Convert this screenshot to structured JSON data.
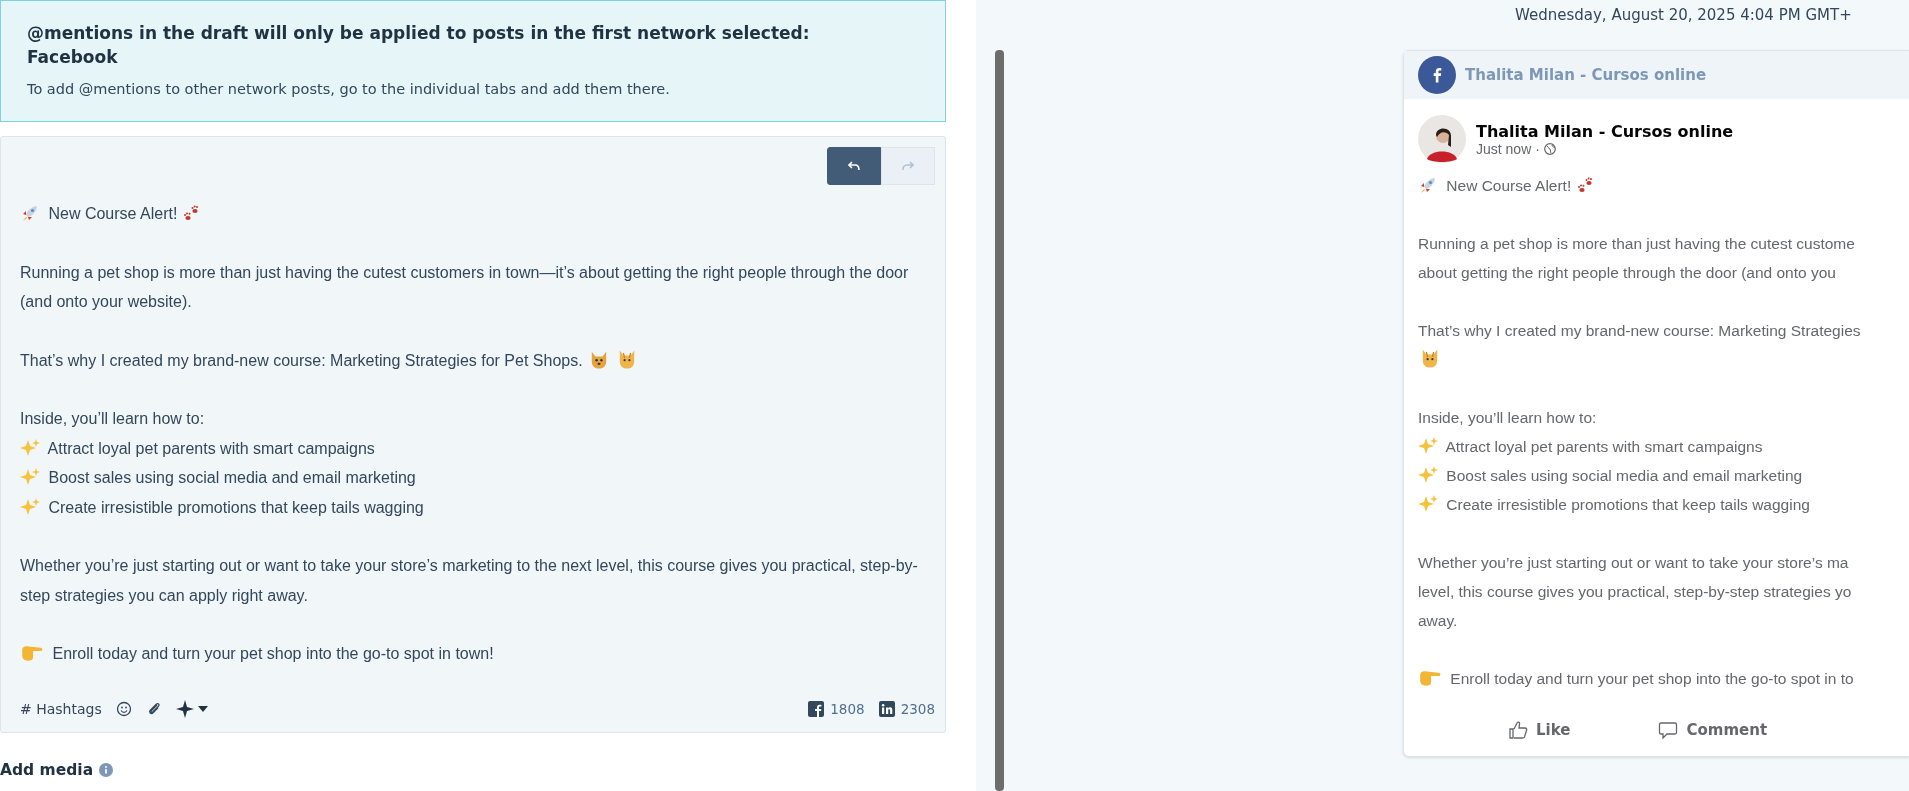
{
  "notice": {
    "title": "@mentions in the draft will only be applied to posts in the first network selected: Facebook",
    "body": "To add @mentions to other network posts, go to the individual tabs and add them there."
  },
  "editor": {
    "history_buttons": [
      {
        "kind": "undo",
        "disabled": false
      },
      {
        "kind": "redo",
        "disabled": true
      }
    ],
    "paragraphs": [
      {
        "kind": "headline",
        "text": "New Course Alert!"
      },
      {
        "kind": "body",
        "text": "Running a pet shop is more than just having the cutest customers in town—it’s about getting the right people through the door (and onto your website)."
      },
      {
        "kind": "pets",
        "text": "That’s why I created my brand-new course: Marketing Strategies for Pet Shops."
      },
      {
        "kind": "intro",
        "text": "Inside, you’ll learn how to:"
      },
      {
        "kind": "bullet",
        "text": "Attract loyal pet parents with smart campaigns"
      },
      {
        "kind": "bullet",
        "text": "Boost sales using social media and email marketing"
      },
      {
        "kind": "bullet",
        "text": "Create irresistible promotions that keep tails wagging"
      },
      {
        "kind": "gap_before",
        "text": "Whether you’re just starting out or want to take your store’s marketing to the next level, this course gives you practical, step-by-step strategies you can apply right away."
      },
      {
        "kind": "cta",
        "text": "Enroll today and turn your pet shop into the go-to spot in town!"
      }
    ],
    "hashtags_label": "# Hashtags",
    "counters": [
      {
        "kind": "facebook",
        "count": "1808"
      },
      {
        "kind": "linkedin",
        "count": "2308"
      }
    ]
  },
  "add_media": {
    "label": "Add media"
  },
  "preview": {
    "scheduled_time": "Wednesday, August 20, 2025 4:04 PM GMT+",
    "network_account": "Thalita Milan - Cursos online",
    "author": "Thalita Milan - Cursos online",
    "posted": "Just now ·",
    "paragraphs": [
      {
        "kind": "headline",
        "lines": [
          "New Course Alert!"
        ]
      },
      {
        "kind": "body",
        "lines": [
          "Running a pet shop is more than just having the cutest custome",
          "about getting the right people through the door (and onto you"
        ]
      },
      {
        "kind": "pets",
        "lines": [
          "That’s why I created my brand-new course: Marketing Strategies"
        ]
      },
      {
        "kind": "intro",
        "lines": [
          "Inside, you’ll learn how to:"
        ]
      },
      {
        "kind": "bullet",
        "lines": [
          "Attract loyal pet parents with smart campaigns"
        ]
      },
      {
        "kind": "bullet",
        "lines": [
          "Boost sales using social media and email marketing"
        ]
      },
      {
        "kind": "bullet",
        "lines": [
          "Create irresistible promotions that keep tails wagging"
        ]
      },
      {
        "kind": "gap_before",
        "lines": [
          "Whether you’re just starting out or want to take your store’s ma",
          "level, this course gives you practical, step-by-step strategies yo",
          "away."
        ]
      },
      {
        "kind": "cta",
        "lines": [
          "Enroll today and turn your pet shop into the go-to spot in to"
        ]
      }
    ],
    "actions": [
      {
        "kind": "like",
        "label": "Like"
      },
      {
        "kind": "comment",
        "label": "Comment"
      }
    ]
  }
}
